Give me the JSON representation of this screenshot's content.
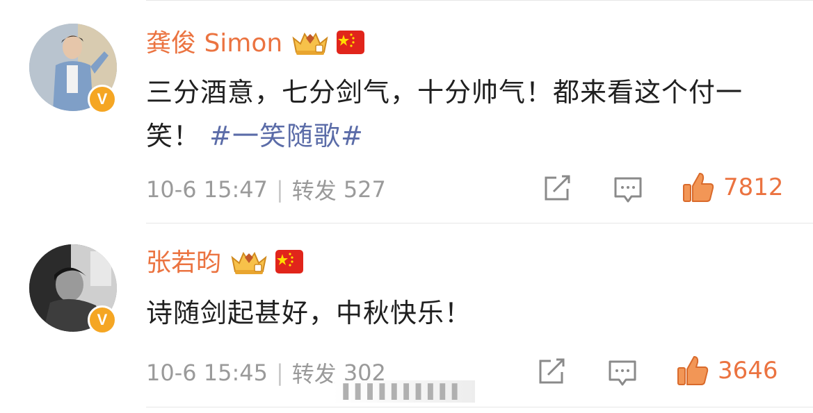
{
  "comments": [
    {
      "username": "龚俊 Simon",
      "text": "三分酒意，七分剑气，十分帅气！都来看这个付一笑！",
      "topic": "#一笑随歌#",
      "time": "10-6 15:47",
      "repost_label": "转发",
      "repost_count": "527",
      "like_count": "7812",
      "verified_badge": "V"
    },
    {
      "username": "张若昀",
      "text": "诗随剑起甚好，中秋快乐！",
      "time": "10-6 15:45",
      "repost_label": "转发",
      "repost_count": "302",
      "like_count": "3646",
      "verified_badge": "V"
    }
  ],
  "watermark": "▌▌▌▌▌▌▌▌▌▌",
  "colors": {
    "username": "#eb7340",
    "topic": "#5b6ca8",
    "meta": "#9a9a9a",
    "badge": "#f5a623"
  },
  "icons": [
    "crown-icon",
    "china-flag-icon",
    "share-icon",
    "comment-icon",
    "thumbs-up-icon"
  ]
}
